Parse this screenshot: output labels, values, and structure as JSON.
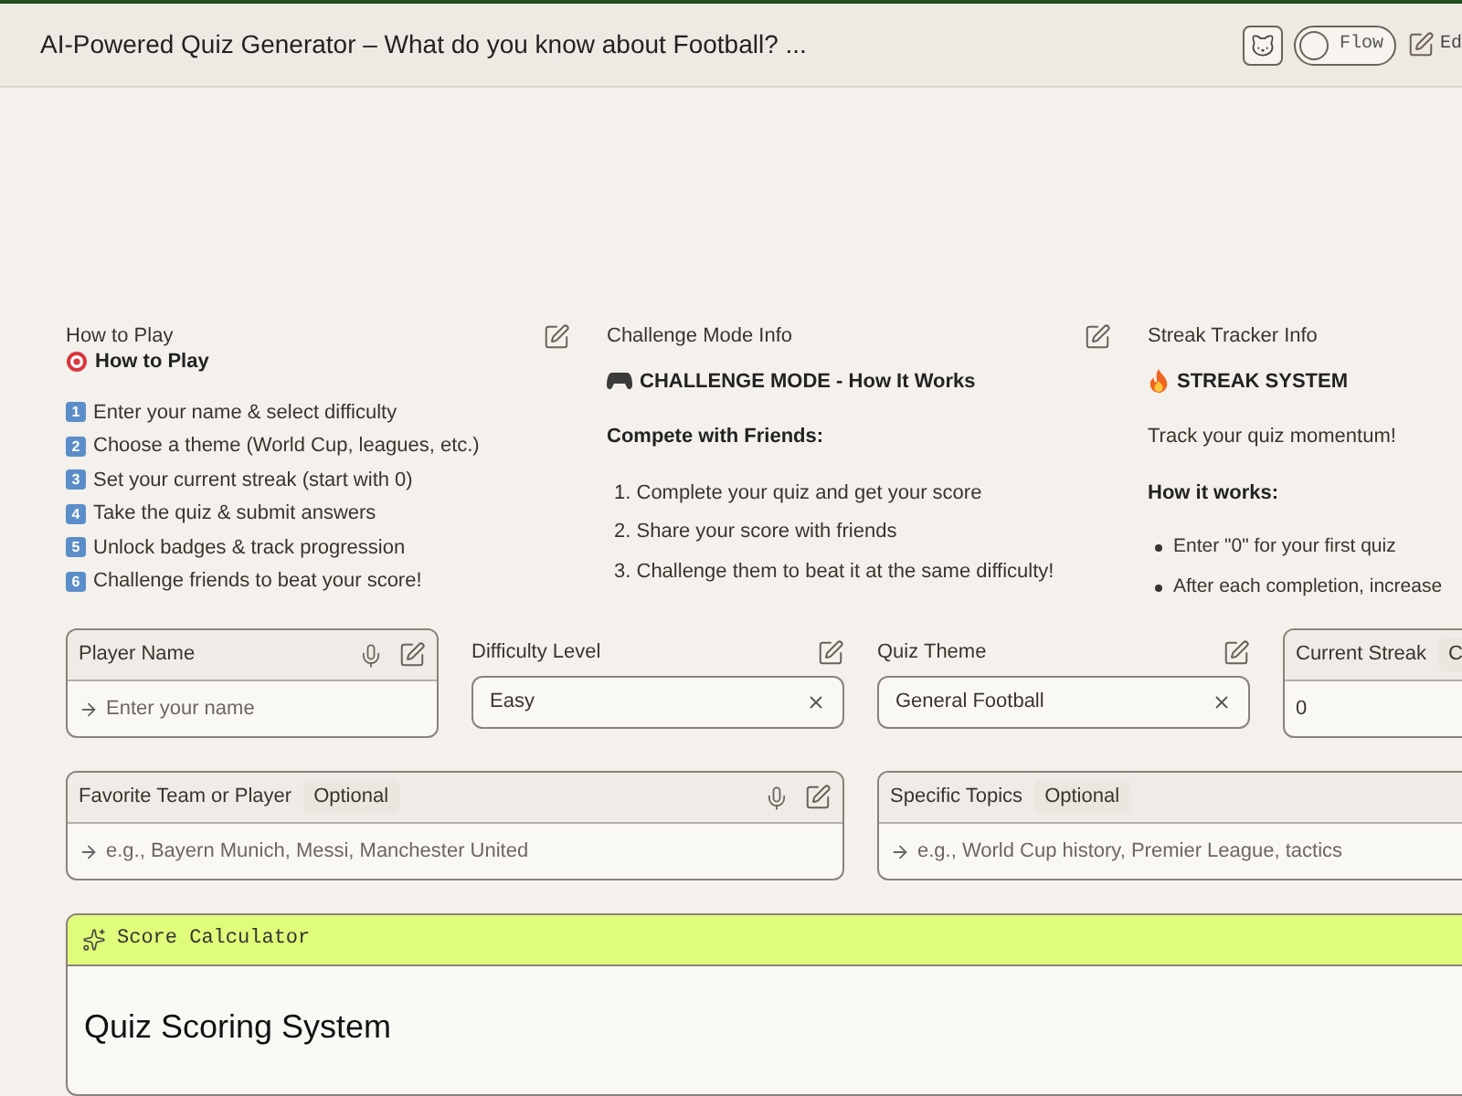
{
  "header": {
    "title": "AI-Powered Quiz Generator – What do you know about Football? ...",
    "flow_toggle": {
      "label": "Flow",
      "on": false
    },
    "edit_label": "Ed"
  },
  "info_panels": [
    {
      "kind": "steps",
      "title": "How to Play",
      "heading": "How to Play",
      "steps": [
        {
          "badge": "1",
          "text": "Enter your name & select difficulty"
        },
        {
          "badge": "2",
          "text": "Choose a theme (World Cup, leagues, etc.)"
        },
        {
          "badge": "3",
          "text": "Set your current streak (start with 0)"
        },
        {
          "badge": "4",
          "text": "Take the quiz & submit answers"
        },
        {
          "badge": "5",
          "text": "Unlock badges & track progression"
        },
        {
          "badge": "6",
          "text": "Challenge friends to beat your score!"
        }
      ]
    },
    {
      "kind": "numbered",
      "title": "Challenge Mode Info",
      "heading": "CHALLENGE MODE - How It Works",
      "subheading": "Compete with Friends:",
      "items": [
        {
          "marker": "1.",
          "text": "Complete your quiz and get your score"
        },
        {
          "marker": "2.",
          "text": "Share your score with friends"
        },
        {
          "marker": "3.",
          "text": "Challenge them to beat it at the same difficulty!"
        }
      ]
    },
    {
      "kind": "bullets",
      "title": "Streak Tracker Info",
      "heading": "STREAK SYSTEM",
      "intro": "Track your quiz momentum!",
      "subheading": "How it works:",
      "items": [
        "Enter \"0\" for your first quiz",
        "After each completion, increase"
      ]
    }
  ],
  "fields_row_1": [
    {
      "kind": "text",
      "label": "Player Name",
      "placeholder": "Enter your name"
    },
    {
      "kind": "select",
      "label": "Difficulty Level",
      "value": "Easy"
    },
    {
      "kind": "select",
      "label": "Quiz Theme",
      "value": "General Football"
    },
    {
      "kind": "value",
      "label": "Current Streak",
      "badge": "C",
      "value": "0"
    }
  ],
  "fields_row_2": [
    {
      "kind": "text",
      "label": "Favorite Team or Player",
      "badge": "Optional",
      "placeholder": "e.g., Bayern Munich, Messi, Manchester United"
    },
    {
      "kind": "text",
      "label": "Specific Topics",
      "badge": "Optional",
      "placeholder": "e.g., World Cup history, Premier League, tactics"
    }
  ],
  "score_calculator": {
    "label": "Score Calculator",
    "title": "Quiz Scoring System"
  }
}
